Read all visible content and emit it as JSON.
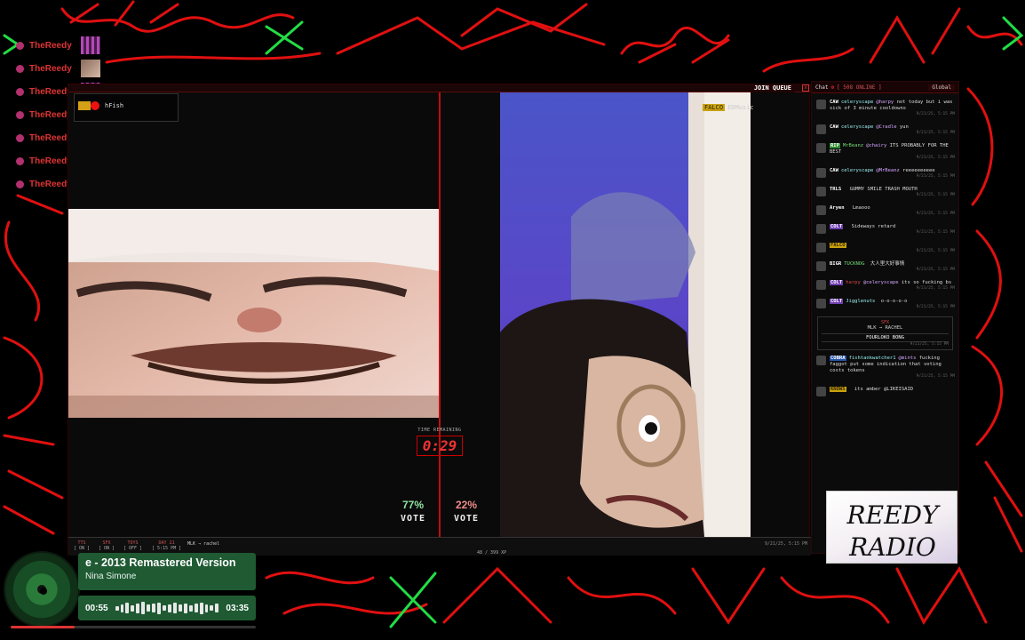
{
  "viewers": [
    {
      "name": "TheReedy",
      "avatar": "wave-avatar"
    },
    {
      "name": "TheReedy",
      "avatar": "face-avatar"
    },
    {
      "name": "TheReedy",
      "avatar": "wave-avatar"
    },
    {
      "name": "TheReedy",
      "avatar": "wave-avatar"
    },
    {
      "name": "TheReedy",
      "avatar": "wave-avatar"
    },
    {
      "name": "TheReedy",
      "avatar": "face-avatar"
    },
    {
      "name": "TheReedy",
      "avatar": "face-avatar"
    }
  ],
  "stream": {
    "join_queue_label": "JOIN QUEUE",
    "close_label": "x",
    "left_cam_user": "hFish",
    "right_cam_tag": "FALCO",
    "right_cam_user": "EDMusic",
    "timer_label": "TIME REMAINING",
    "timer_value": "0:29",
    "vote_left_pct": "77%",
    "vote_right_pct": "22%",
    "vote_label": "VOTE",
    "toolbar": {
      "tts": {
        "label": "TTS",
        "state": "[ ON ]"
      },
      "sfx": {
        "label": "SFX",
        "state": "[ ON ]"
      },
      "toys": {
        "label": "TOYS",
        "state": "[ OFF ]"
      },
      "day": {
        "label": "DAY 21",
        "state": "[ 5:15 PM ]"
      },
      "route": "MLK → rachel",
      "xp": "48 / 399 XP",
      "date": "9/21/25, 5:15 PM"
    }
  },
  "chat": {
    "title": "Chat",
    "online": "[ 508 ONLINE ]",
    "scope": "Global",
    "messages": [
      {
        "badge": "CAW",
        "badge_class": "",
        "user": "celeryscape",
        "user_class": "",
        "mention": "@harpy",
        "text": "not today but i was sick of 3 minute cooldowns",
        "ts": "9/21/25, 5:15 PM"
      },
      {
        "badge": "CAW",
        "badge_class": "",
        "user": "celeryscape",
        "user_class": "",
        "mention": "@Cradle",
        "text": "yun",
        "ts": "9/21/25, 5:15 PM"
      },
      {
        "badge": "RIP",
        "badge_class": "b-rip",
        "user": "MrBeanz",
        "user_class": "u-green",
        "mention": "@chairy",
        "text": "ITS PROBABLY FOR THE BEST",
        "ts": "9/21/25, 5:15 PM"
      },
      {
        "badge": "CAW",
        "badge_class": "",
        "user": "celeryscape",
        "user_class": "",
        "mention": "@MrBeanz",
        "text": "reeeeeeeeee",
        "ts": "9/21/25, 5:15 PM"
      },
      {
        "badge": "TRLS",
        "badge_class": "",
        "user": "",
        "user_class": "u-red",
        "mention": "",
        "text": "GUMMY SMILE TRASH MOUTH",
        "ts": "9/21/25, 5:15 PM"
      },
      {
        "badge": "Aryen",
        "badge_class": "",
        "user": "",
        "user_class": "",
        "mention": "",
        "text": "Lmaooo",
        "ts": "9/21/25, 5:15 PM"
      },
      {
        "badge": "COLT",
        "badge_class": "b-colt",
        "user": "",
        "user_class": "u-red",
        "mention": "",
        "text": "Sideways retard",
        "ts": "9/21/25, 5:15 PM"
      },
      {
        "badge": "FALCO",
        "badge_class": "b-falco",
        "user": "",
        "user_class": "u-red",
        "mention": "",
        "text": "",
        "ts": "9/21/25, 5:15 PM"
      },
      {
        "badge": "BIGR",
        "badge_class": "",
        "user": "TUCKNOG",
        "user_class": "u-green",
        "mention": "",
        "text": "大人里大好事情",
        "ts": "9/21/25, 5:15 PM"
      },
      {
        "badge": "COLT",
        "badge_class": "b-colt",
        "user": "harpy",
        "user_class": "u-red",
        "mention": "@celeryscape",
        "text": "its so fucking bs",
        "ts": "9/21/25, 5:15 PM"
      },
      {
        "badge": "COLT",
        "badge_class": "b-colt",
        "user": "Jigglenuts",
        "user_class": "",
        "mention": "",
        "text": "o-o-o-o-o",
        "ts": "9/21/25, 5:15 PM"
      }
    ],
    "sfx_card": {
      "title": "SFX",
      "route": "MLK → RACHEL",
      "sound": "FOURLOKO BONG",
      "ts": "9/21/25, 5:15 PM"
    },
    "messages_after": [
      {
        "badge": "COBRA",
        "badge_class": "b-cobra",
        "user": "fishtankwatcher1",
        "user_class": "",
        "mention": "@mints",
        "text": "fucking faggot put some indication that voting costs tokens",
        "ts": "9/21/25, 5:15 PM"
      },
      {
        "badge": "KNOWS",
        "badge_class": "b-knows",
        "user": "",
        "user_class": "u-red",
        "mention": "",
        "text": "its amber @LIKEISAID",
        "ts": ""
      }
    ]
  },
  "logo": {
    "line1": "REEDY",
    "line2": "RADIO"
  },
  "now_playing": {
    "title": "e - 2013 Remastered Version",
    "artist": "Nina Simone",
    "elapsed": "00:55",
    "total": "03:35",
    "progress": 0.26
  },
  "colors": {
    "accent": "#e11111",
    "panel_green": "#1f5a33",
    "vote_yes": "#8fe3a0",
    "vote_no": "#f08b8b"
  }
}
